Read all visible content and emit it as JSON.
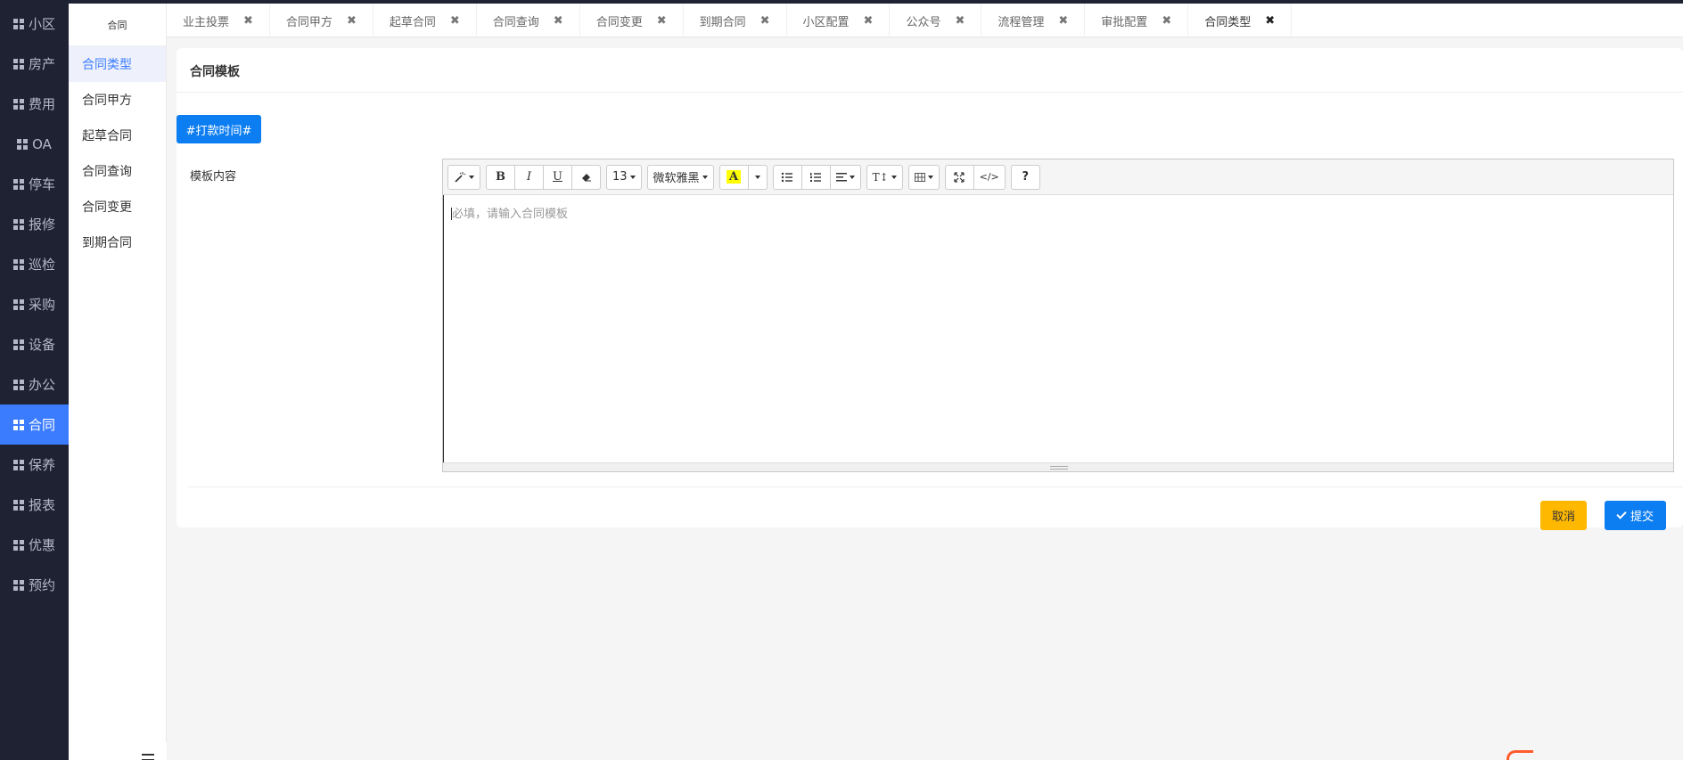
{
  "left_nav": {
    "items": [
      {
        "label": "小区",
        "active": false
      },
      {
        "label": "房产",
        "active": false
      },
      {
        "label": "费用",
        "active": false
      },
      {
        "label": "OA",
        "active": false
      },
      {
        "label": "停车",
        "active": false
      },
      {
        "label": "报修",
        "active": false
      },
      {
        "label": "巡检",
        "active": false
      },
      {
        "label": "采购",
        "active": false
      },
      {
        "label": "设备",
        "active": false
      },
      {
        "label": "办公",
        "active": false
      },
      {
        "label": "合同",
        "active": true
      },
      {
        "label": "保养",
        "active": false
      },
      {
        "label": "报表",
        "active": false
      },
      {
        "label": "优惠",
        "active": false
      },
      {
        "label": "预约",
        "active": false
      }
    ]
  },
  "sub_nav": {
    "header": "合同",
    "items": [
      {
        "label": "合同类型",
        "active": true
      },
      {
        "label": "合同甲方",
        "active": false
      },
      {
        "label": "起草合同",
        "active": false
      },
      {
        "label": "合同查询",
        "active": false
      },
      {
        "label": "合同变更",
        "active": false
      },
      {
        "label": "到期合同",
        "active": false
      }
    ]
  },
  "tabs": [
    {
      "label": "业主投票",
      "active": false
    },
    {
      "label": "合同甲方",
      "active": false
    },
    {
      "label": "起草合同",
      "active": false
    },
    {
      "label": "合同查询",
      "active": false
    },
    {
      "label": "合同变更",
      "active": false
    },
    {
      "label": "到期合同",
      "active": false
    },
    {
      "label": "小区配置",
      "active": false
    },
    {
      "label": "公众号",
      "active": false
    },
    {
      "label": "流程管理",
      "active": false
    },
    {
      "label": "审批配置",
      "active": false
    },
    {
      "label": "合同类型",
      "active": true
    }
  ],
  "tab_close_glyph": "✖",
  "card": {
    "title": "合同模板",
    "tag_button": "#打款时间#",
    "field_label": "模板内容"
  },
  "editor": {
    "placeholder": "必填，请输入合同模板",
    "toolbar": {
      "font_size": "13",
      "font_name": "微软雅黑",
      "bold": "B",
      "italic": "I",
      "underline": "U",
      "color_a": "A",
      "text_height": "T↕",
      "code": "</>",
      "help": "?"
    }
  },
  "actions": {
    "cancel": "取消",
    "submit": "提交"
  },
  "colors": {
    "primary": "#0d7ef2",
    "nav_active": "#3b7cff",
    "nav_bg": "#1f2233",
    "warning": "#ffb800"
  }
}
